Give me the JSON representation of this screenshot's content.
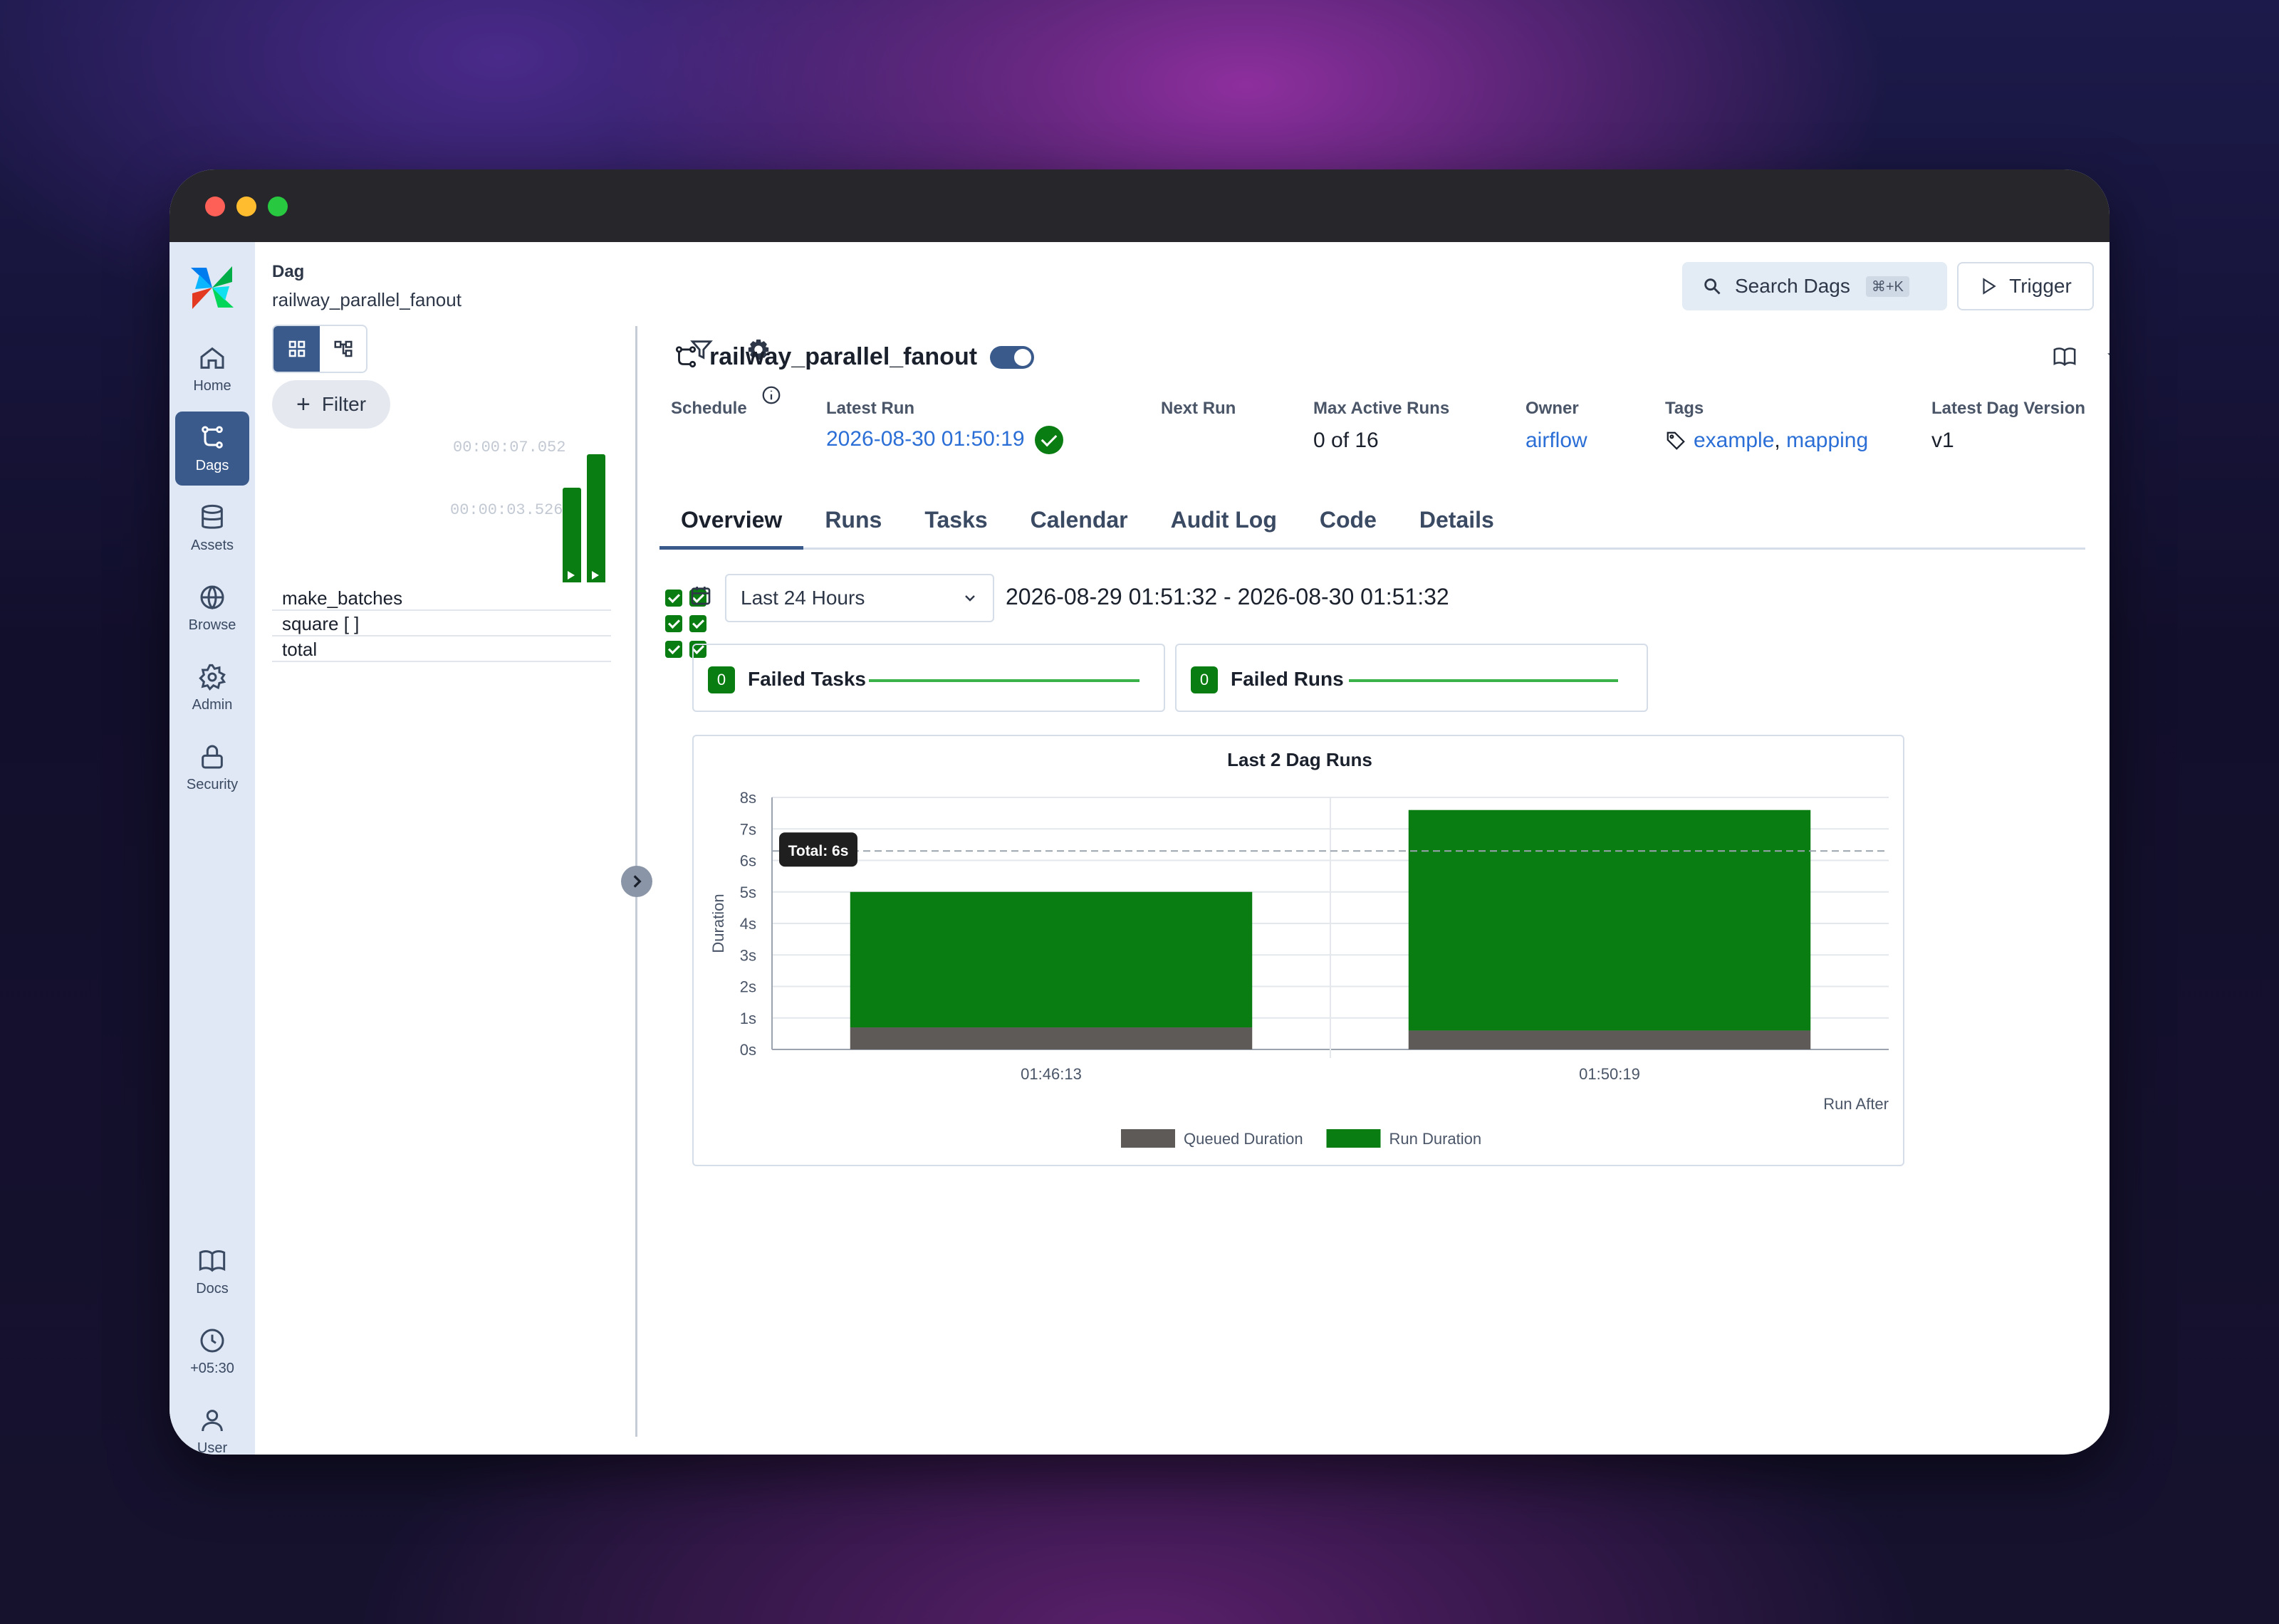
{
  "window": {
    "traffic_lights": [
      "close",
      "minimize",
      "zoom"
    ]
  },
  "nav": {
    "items": [
      {
        "label": "Home",
        "icon": "home-icon"
      },
      {
        "label": "Dags",
        "icon": "dag-icon",
        "active": true
      },
      {
        "label": "Assets",
        "icon": "database-icon"
      },
      {
        "label": "Browse",
        "icon": "globe-icon"
      },
      {
        "label": "Admin",
        "icon": "gear-icon"
      },
      {
        "label": "Security",
        "icon": "lock-icon"
      }
    ],
    "bottom_items": [
      {
        "label": "Docs",
        "icon": "book-icon"
      },
      {
        "label": "+05:30",
        "icon": "clock-icon"
      },
      {
        "label": "User",
        "icon": "user-icon"
      }
    ]
  },
  "breadcrumb": {
    "label": "Dag",
    "name": "railway_parallel_fanout"
  },
  "header": {
    "search_label": "Search Dags",
    "search_shortcut": "⌘+K",
    "trigger_label": "Trigger"
  },
  "grid": {
    "filter_label": "Filter",
    "duration_labels": [
      "00:00:07.052",
      "00:00:03.526"
    ],
    "runs": [
      {
        "duration_fraction": 0.74,
        "state": "success"
      },
      {
        "duration_fraction": 1.0,
        "state": "success"
      }
    ],
    "tasks": [
      {
        "name": "make_batches",
        "states": [
          "success",
          "success"
        ]
      },
      {
        "name": "square [ ]",
        "states": [
          "success",
          "success"
        ]
      },
      {
        "name": "total",
        "states": [
          "success",
          "success"
        ]
      }
    ]
  },
  "dag": {
    "title": "railway_parallel_fanout",
    "paused": false,
    "meta": {
      "schedule_label": "Schedule",
      "schedule_value": "",
      "latest_run_label": "Latest Run",
      "latest_run_value": "2026-08-30 01:50:19",
      "next_run_label": "Next Run",
      "next_run_value": "",
      "max_active_label": "Max Active Runs",
      "max_active_value": "0 of 16",
      "owner_label": "Owner",
      "owner_value": "airflow",
      "tags_label": "Tags",
      "tag_1": "example",
      "tag_sep": ", ",
      "tag_2": "mapping",
      "version_label": "Latest Dag Version",
      "version_value": "v1"
    },
    "tabs": [
      "Overview",
      "Runs",
      "Tasks",
      "Calendar",
      "Audit Log",
      "Code",
      "Details"
    ],
    "active_tab": "Overview"
  },
  "overview": {
    "range_select": "Last 24 Hours",
    "range_text": "2026-08-29 01:51:32 - 2026-08-30 01:51:32",
    "failed_tasks": {
      "count": "0",
      "label": "Failed Tasks"
    },
    "failed_runs": {
      "count": "0",
      "label": "Failed Runs"
    }
  },
  "colors": {
    "accent": "#3a5a8c",
    "success": "#0a7d12",
    "queued": "#5d5a58",
    "link": "#2b6fd6",
    "danger": "#c62828"
  },
  "chart_data": {
    "type": "bar",
    "title": "Last 2 Dag Runs",
    "ylabel": "Duration",
    "xlabel": "Run After",
    "categories": [
      "01:46:13",
      "01:50:19"
    ],
    "stacked": true,
    "series": [
      {
        "name": "Queued Duration",
        "values": [
          0.7,
          0.6
        ],
        "color": "#5d5a58"
      },
      {
        "name": "Run Duration",
        "values": [
          4.3,
          7.0
        ],
        "color": "#0a7d12"
      }
    ],
    "ylim": [
      0,
      8
    ],
    "yticks": [
      "0s",
      "1s",
      "2s",
      "3s",
      "4s",
      "5s",
      "6s",
      "7s",
      "8s"
    ],
    "reference_line": {
      "value": 6.3,
      "label": "Total: 6s"
    },
    "grid": true,
    "legend": "bottom"
  }
}
